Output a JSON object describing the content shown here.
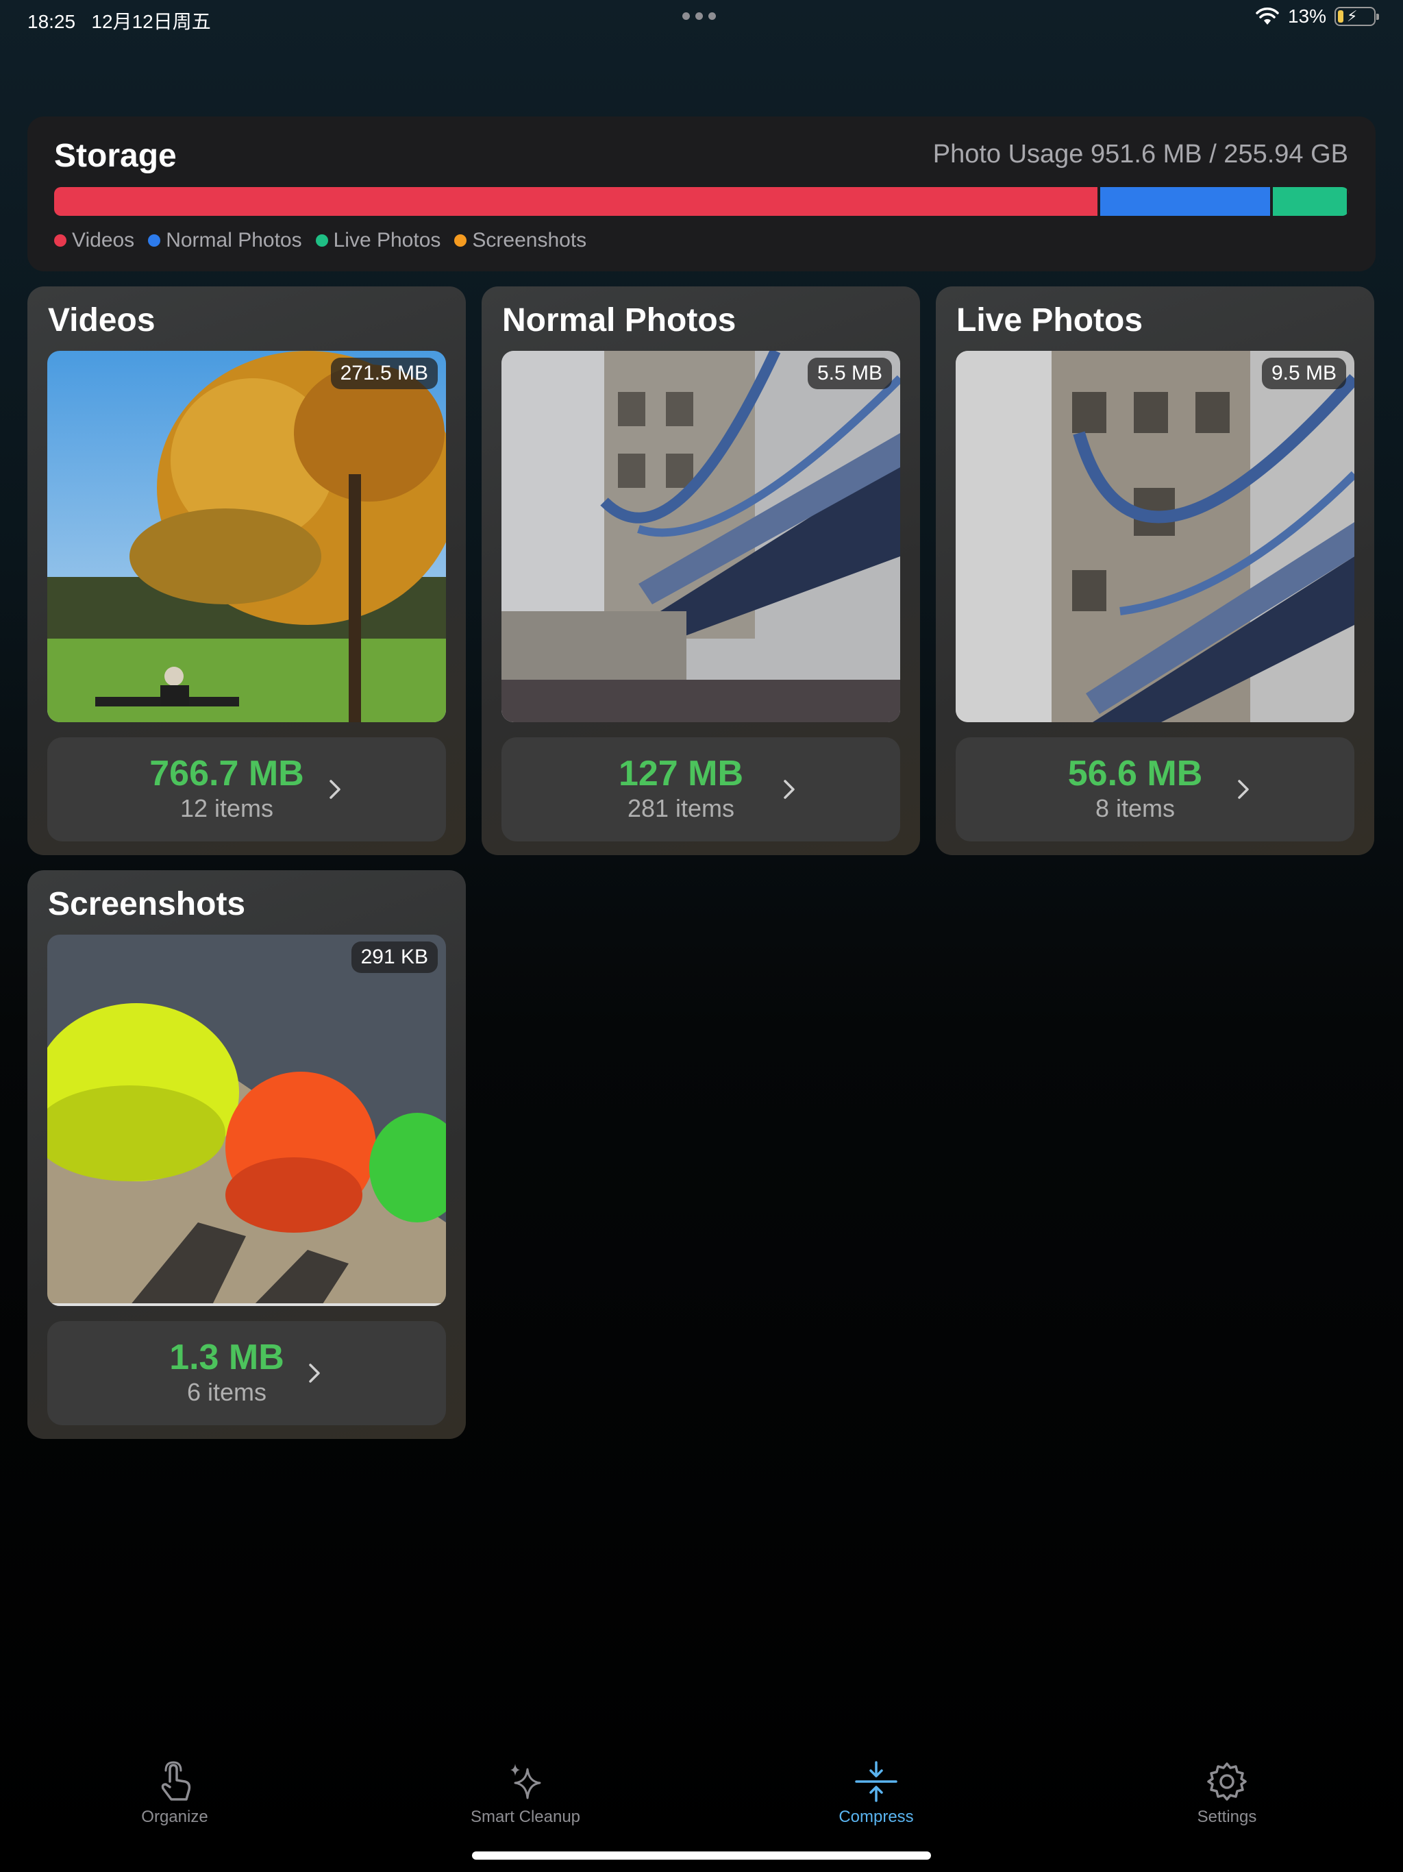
{
  "status_bar": {
    "time": "18:25",
    "date": "12月12日周五",
    "battery": "13%"
  },
  "storage": {
    "title": "Storage",
    "usage": "Photo Usage 951.6 MB / 255.94 GB",
    "breakdown": [
      {
        "name": "Videos",
        "size_mb": 766.7,
        "color": "#e8394e"
      },
      {
        "name": "Normal Photos",
        "size_mb": 127,
        "color": "#2d7bec"
      },
      {
        "name": "Live Photos",
        "size_mb": 56.6,
        "color": "#1fbf85"
      },
      {
        "name": "Screenshots",
        "size_mb": 1.3,
        "color": "#f59b20"
      }
    ],
    "legend": [
      "Videos",
      "Normal Photos",
      "Live Photos",
      "Screenshots"
    ]
  },
  "categories": [
    {
      "title": "Videos",
      "badge": "271.5 MB",
      "size": "766.7 MB",
      "items": "12 items"
    },
    {
      "title": "Normal Photos",
      "badge": "5.5 MB",
      "size": "127 MB",
      "items": "281 items"
    },
    {
      "title": "Live Photos",
      "badge": "9.5 MB",
      "size": "56.6 MB",
      "items": "8 items"
    },
    {
      "title": "Screenshots",
      "badge": "291 KB",
      "size": "1.3 MB",
      "items": "6 items"
    }
  ],
  "tabs": [
    {
      "label": "Organize",
      "icon": "hand-tap-icon",
      "active": false
    },
    {
      "label": "Smart Cleanup",
      "icon": "sparkles-icon",
      "active": false
    },
    {
      "label": "Compress",
      "icon": "compress-icon",
      "active": true
    },
    {
      "label": "Settings",
      "icon": "gear-icon",
      "active": false
    }
  ],
  "colors": {
    "accent": "#5ab4f0",
    "size_green": "#4cc35c"
  }
}
